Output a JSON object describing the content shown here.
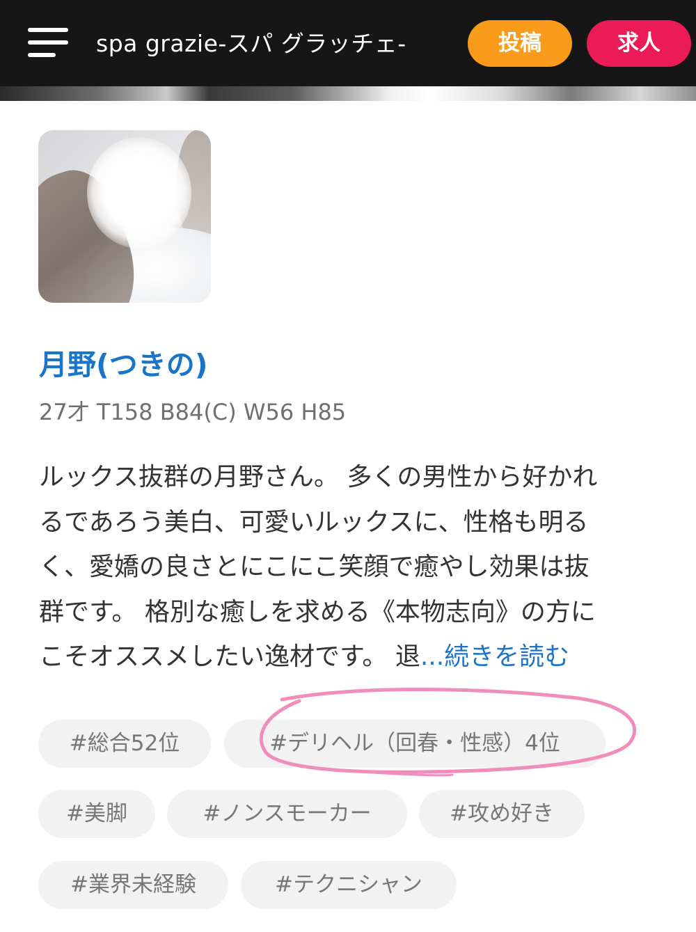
{
  "header": {
    "menu_icon": "hamburger-menu-icon",
    "title": "spa grazie-スパ グラッチェ-",
    "post_button": "投稿",
    "jobs_button": "求人",
    "post_color": "#fb9b1c",
    "jobs_color": "#ea1b56"
  },
  "profile": {
    "name": "月野(つきの)",
    "stats": "27才 T158 B84(C) W56 H85",
    "description_lines": [
      "ルックス抜群の月野さん。 多くの男性から好かれ",
      "るであろう美白、可愛いルックスに、性格も明る",
      "く、愛嬌の良さとにこにこ笑顔で癒やし効果は抜",
      "群です。 格別な癒しを求める《本物志向》の方に",
      "こそオススメしたい逸材です。 退"
    ],
    "read_more": "...続きを読む"
  },
  "tags": [
    "#総合52位",
    "#デリヘル（回春・性感）4位",
    "#美脚",
    "#ノンスモーカー",
    "#攻め好き",
    "#業界未経験",
    "#テクニシャン"
  ],
  "accent_color": "#1a75c9",
  "annotation_color": "#f08dbb"
}
